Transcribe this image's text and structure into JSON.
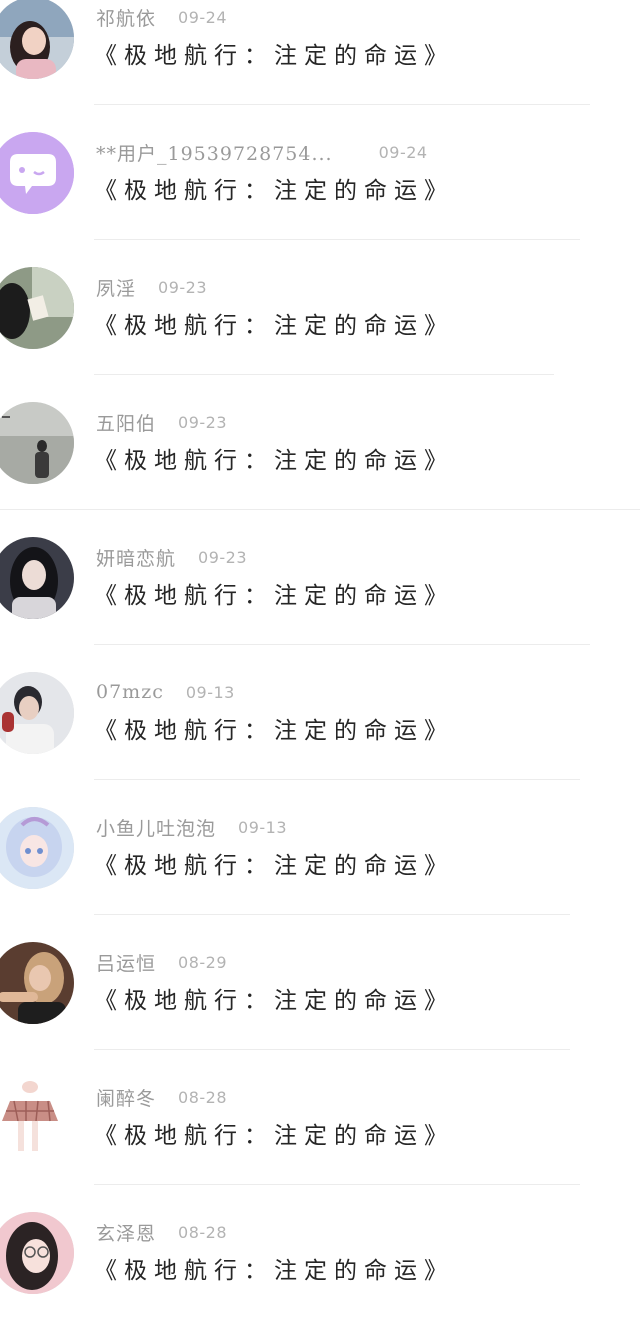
{
  "comments": [
    {
      "user": "祁航依",
      "date": "09-24",
      "text": "《极地航行：注定的命运》",
      "avatar": "girl-sea-avatar"
    },
    {
      "user": "**用户_19539728754...",
      "date": "09-24",
      "text": "《极地航行：注定的命运》",
      "avatar": "default-chat-avatar"
    },
    {
      "user": "夙淫",
      "date": "09-23",
      "text": "《极地航行：注定的命运》",
      "avatar": "reading-window-avatar"
    },
    {
      "user": "五阳伯",
      "date": "09-23",
      "text": "《极地航行：注定的命运》",
      "avatar": "man-seaside-avatar"
    },
    {
      "user": "妍暗恋航",
      "date": "09-23",
      "text": "《极地航行：注定的命运》",
      "avatar": "girl-dark-hair-avatar"
    },
    {
      "user": "07mzc",
      "date": "09-13",
      "text": "《极地航行：注定的命运》",
      "avatar": "man-portrait-avatar"
    },
    {
      "user": "小鱼儿吐泡泡",
      "date": "09-13",
      "text": "《极地航行：注定的命运》",
      "avatar": "anime-girl-avatar"
    },
    {
      "user": "吕运恒",
      "date": "08-29",
      "text": "《极地航行：注定的命运》",
      "avatar": "woman-cigarette-avatar"
    },
    {
      "user": "阑醉冬",
      "date": "08-28",
      "text": "《极地航行：注定的命运》",
      "avatar": "plaid-skirt-avatar"
    },
    {
      "user": "玄泽恩",
      "date": "08-28",
      "text": "《极地航行：注定的命运》",
      "avatar": "girl-glasses-avatar"
    }
  ],
  "colors": {
    "username": "#9a9a9a",
    "date": "#b3b3b3",
    "text": "#262626",
    "divider": "#ececec",
    "default_avatar": "#c9a7f0"
  }
}
